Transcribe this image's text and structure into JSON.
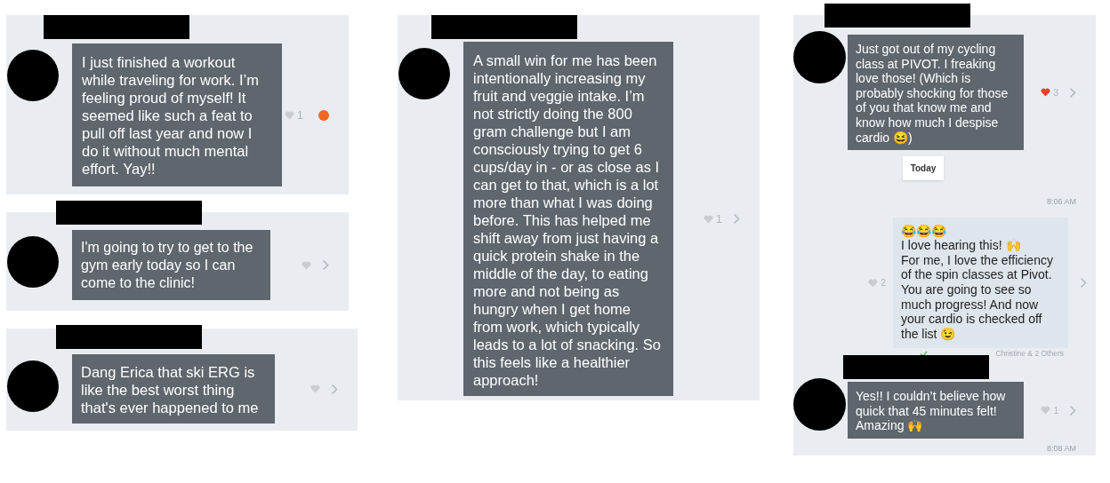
{
  "panels": [
    {
      "items": [
        {
          "kind": "incoming",
          "text": "I just finished a workout while traveling for work. I’m feeling proud of myself! It seemed like such a feat to pull off last year and now I do it without much mental effort. Yay!!",
          "likes": "1",
          "liked": false,
          "unread": true
        }
      ]
    },
    {
      "items": [
        {
          "kind": "incoming",
          "text": "I'm going to try to get to the gym early today so I can come to the clinic!",
          "liked": false,
          "unread": false
        }
      ]
    },
    {
      "items": [
        {
          "kind": "incoming",
          "text": "Dang Erica that ski ERG is like the best worst thing that's ever happened to me",
          "liked": false,
          "unread": false
        }
      ]
    },
    {
      "items": [
        {
          "kind": "incoming",
          "text": "A small win for me has been intentionally increasing my fruit and veggie intake. I’m not strictly doing the 800 gram challenge but I am consciously trying to get 6 cups/day in - or as close as I can get to that, which is a lot more than what I was doing before. This has helped me shift away from just having a quick protein shake in the middle of the day, to eating more and not being as hungry when I get home from work, which typically leads to a lot of snacking. So this feels like a healthier approach!",
          "likes": "1",
          "liked": false,
          "unread": false
        }
      ]
    },
    {
      "items": [
        {
          "kind": "incoming",
          "text": "Just got out of my cycling class at PIVOT. I freaking love those! (Which is probably shocking for those of you that know me and know how much I despise cardio 😆)",
          "likes": "3",
          "liked": true,
          "unread": false
        },
        {
          "kind": "date",
          "text": "Today"
        },
        {
          "kind": "time",
          "text": "8:06 AM"
        },
        {
          "kind": "outgoing",
          "text": "😂😂😂\nI love hearing this! 🙌\nFor me, I love the efficiency of the spin classes at Pivot. You are going to see so much progress! And now your cardio is checked off the list 😉",
          "likes": "2",
          "liked": false
        },
        {
          "kind": "receipt",
          "text": "Christine & 2 Others"
        },
        {
          "kind": "incoming",
          "text": "Yes!! I couldn’t believe how quick that 45 minutes felt! Amazing 🙌",
          "likes": "1",
          "liked": false,
          "unread": false
        },
        {
          "kind": "time",
          "text": "8:08 AM"
        }
      ]
    }
  ]
}
